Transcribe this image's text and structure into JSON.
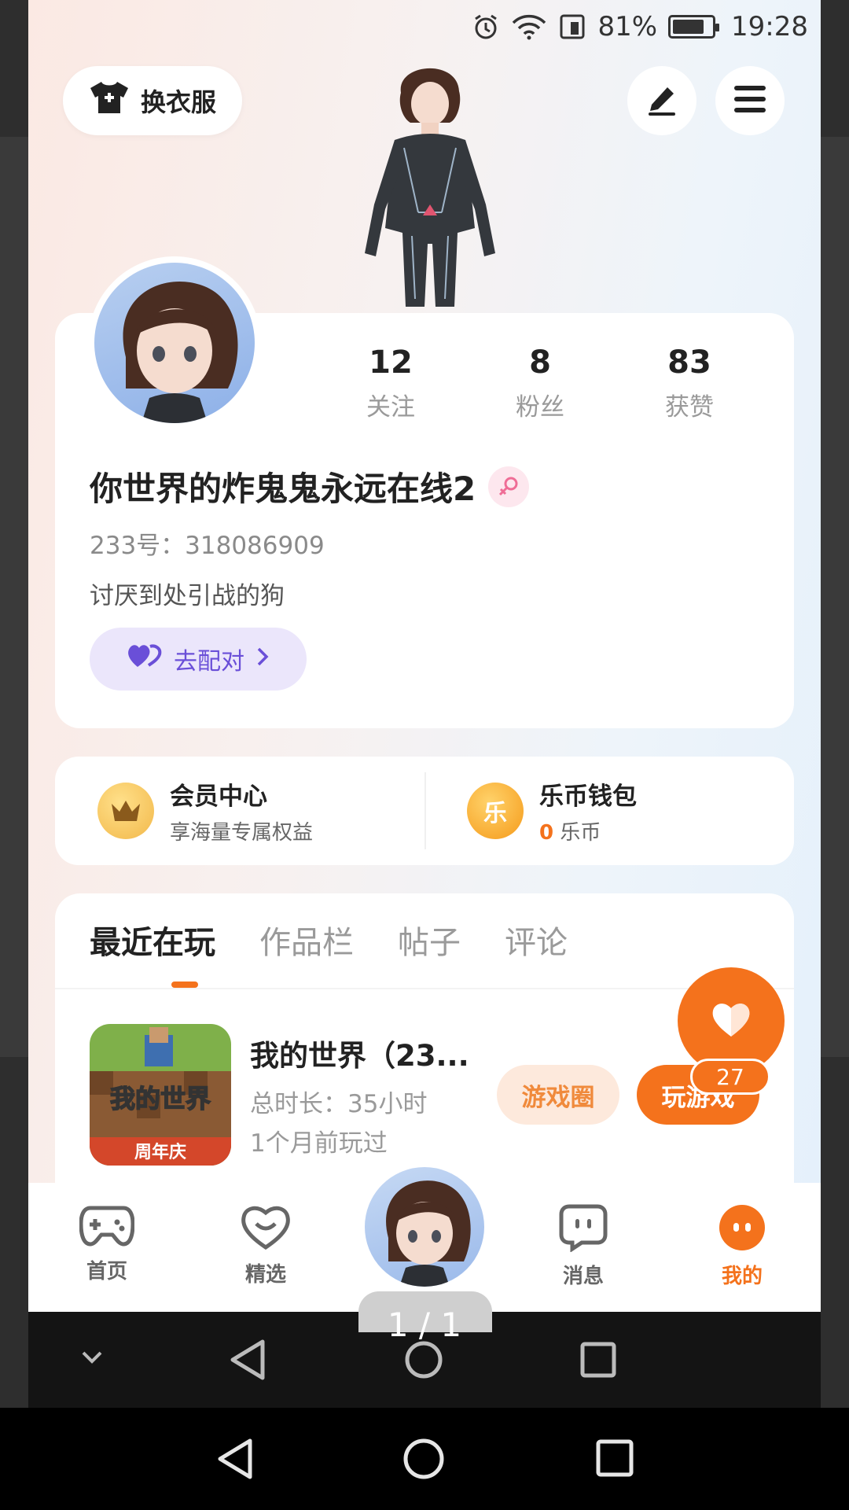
{
  "status_bar": {
    "battery": "81%",
    "time": "19:28"
  },
  "header": {
    "outfit_label": "换衣服"
  },
  "profile": {
    "stats": [
      {
        "value": "12",
        "label": "关注"
      },
      {
        "value": "8",
        "label": "粉丝"
      },
      {
        "value": "83",
        "label": "获赞"
      }
    ],
    "nickname": "你世界的炸鬼鬼永远在线2",
    "uid": "233号：318086909",
    "bio": "讨厌到处引战的狗",
    "match_label": "去配对"
  },
  "wallet": {
    "member": {
      "title": "会员中心",
      "subtitle": "享海量专属权益"
    },
    "coins": {
      "title": "乐币钱包",
      "amount": "0",
      "unit": "乐币",
      "coin_glyph": "乐"
    }
  },
  "tabs": [
    "最近在玩",
    "作品栏",
    "帖子",
    "评论"
  ],
  "recent_game": {
    "icon_line1": "我的世界",
    "icon_line2": "周年庆",
    "title": "我的世界（23...",
    "duration": "总时长：35小时",
    "last_played": "1个月前玩过",
    "circle_label": "游戏圈",
    "play_label": "玩游戏"
  },
  "like_fab": {
    "count": "27"
  },
  "bottom_nav": [
    {
      "label": "首页",
      "icon": "gamepad-icon"
    },
    {
      "label": "精选",
      "icon": "heart-chat-icon"
    },
    {
      "label": "消息",
      "icon": "message-icon"
    },
    {
      "label": "我的",
      "icon": "me-icon"
    }
  ],
  "page_indicator": "1 / 1",
  "colors": {
    "accent": "#f4721c",
    "match": "#6a4fd8"
  }
}
